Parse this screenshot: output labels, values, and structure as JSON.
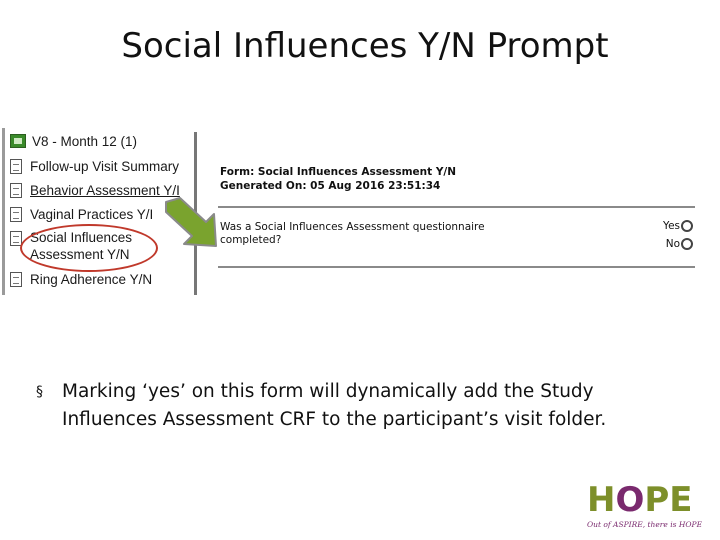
{
  "slide": {
    "title": "Social Influences Y/N Prompt"
  },
  "tree": {
    "items": [
      {
        "label": "V8 - Month 12 (1)",
        "icon": "folder-icon",
        "link": false
      },
      {
        "label": "Follow-up Visit Summary",
        "icon": "document-icon",
        "link": false
      },
      {
        "label": "Behavior Assessment Y/I",
        "icon": "document-icon",
        "link": true
      },
      {
        "label": "Vaginal Practices Y/I",
        "icon": "document-icon",
        "link": false
      },
      {
        "label": "Social Influences",
        "label2": "Assessment Y/N",
        "icon": "document-icon",
        "link": false
      },
      {
        "label": "Ring Adherence Y/N",
        "icon": "document-icon",
        "link": false
      }
    ],
    "highlight_color": "#c0392b"
  },
  "arrow": {
    "color": "#7aa32e",
    "outline": "#8a8a8a"
  },
  "form": {
    "title": "Form: Social Influences Assessment Y/N",
    "generated": "Generated On: 05 Aug 2016 23:51:34",
    "question": "Was a Social Influences Assessment questionnaire completed?",
    "options": [
      "Yes",
      "No"
    ]
  },
  "bullet": {
    "marker": "§",
    "text": "Marking ‘yes’ on this form will dynamically add the Study Influences Assessment CRF to the participant’s visit folder."
  },
  "logo": {
    "word_h": "H",
    "word_o": "O",
    "word_rest": "PE",
    "tagline": "Out of ASPIRE, there is HOPE",
    "colors": {
      "green": "#7d8f2a",
      "purple": "#7a2a6e"
    }
  }
}
